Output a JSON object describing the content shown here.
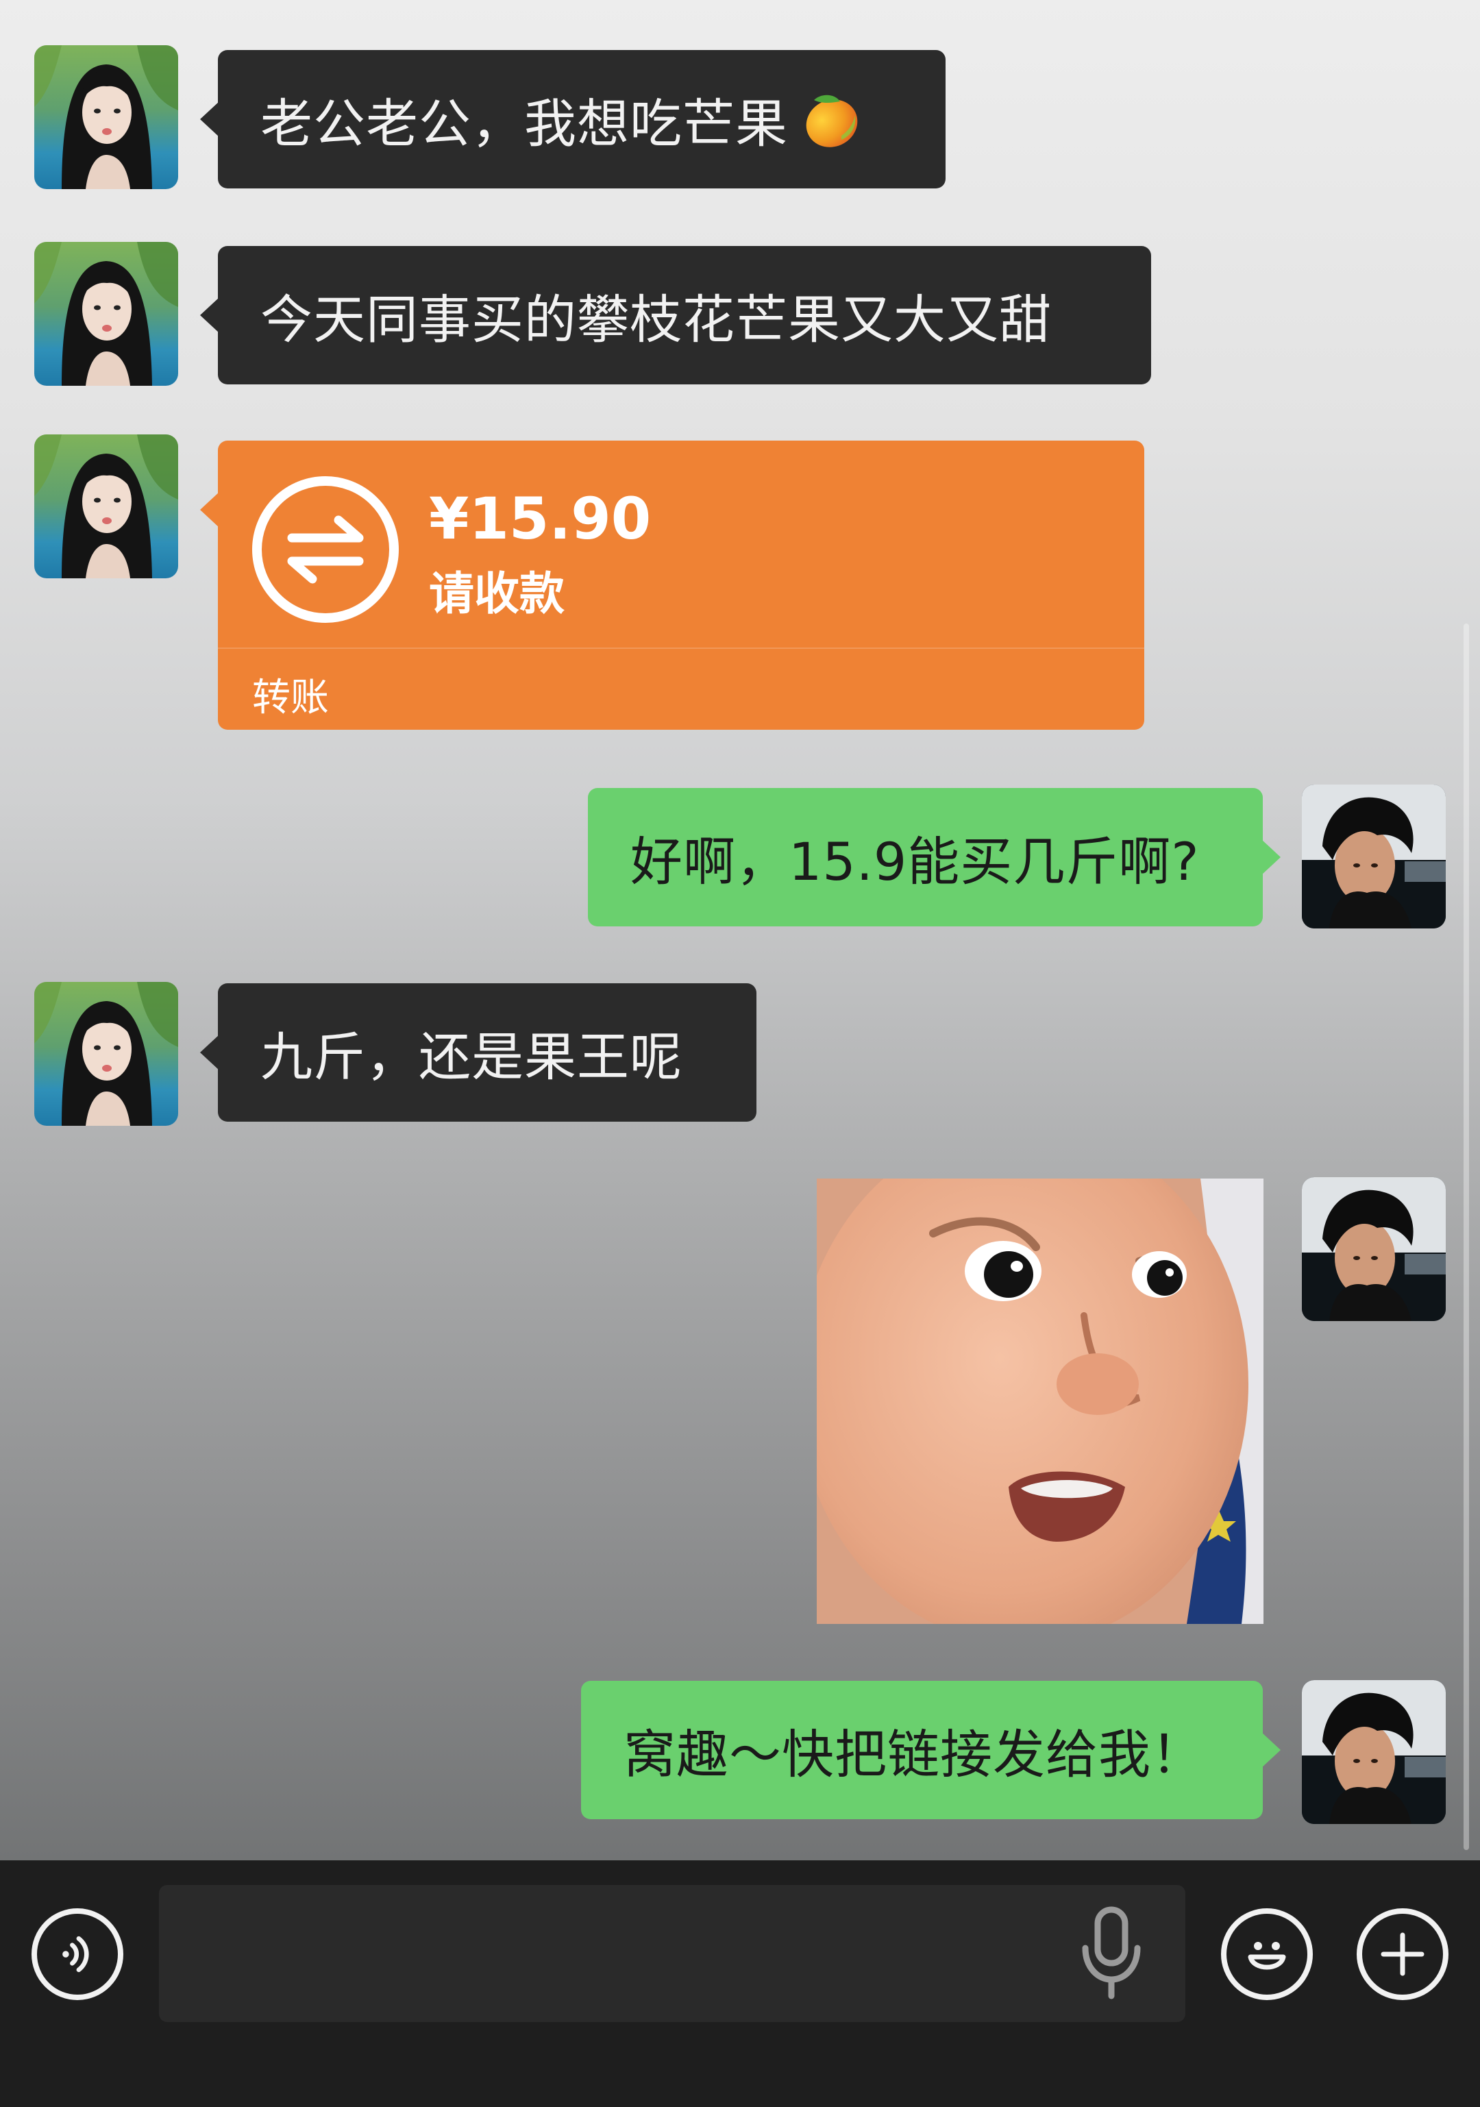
{
  "messages": [
    {
      "from": "her",
      "type": "text",
      "text": "老公老公，我想吃芒果",
      "emoji": "mango-icon"
    },
    {
      "from": "her",
      "type": "text",
      "text": "今天同事买的攀枝花芒果又大又甜"
    },
    {
      "from": "her",
      "type": "transfer",
      "amount": "¥15.90",
      "status": "请收款",
      "label": "转账"
    },
    {
      "from": "me",
      "type": "text",
      "text": "好啊，15.9能买几斤啊?"
    },
    {
      "from": "her",
      "type": "text",
      "text": "九斤，还是果王呢"
    },
    {
      "from": "me",
      "type": "image",
      "description": "baby-meme-sticker"
    },
    {
      "from": "me",
      "type": "text",
      "text": "窝趣～快把链接发给我！"
    }
  ],
  "input_bar": {
    "voice_button": "voice-icon",
    "text_placeholder": "",
    "mic_icon": "mic-icon",
    "emoji_button": "emoji-icon",
    "plus_button": "plus-icon"
  },
  "colors": {
    "incoming_bubble": "#2b2b2b",
    "outgoing_bubble": "#6ad06e",
    "transfer_card": "#ef8234",
    "input_bar": "#1e1e1e"
  }
}
